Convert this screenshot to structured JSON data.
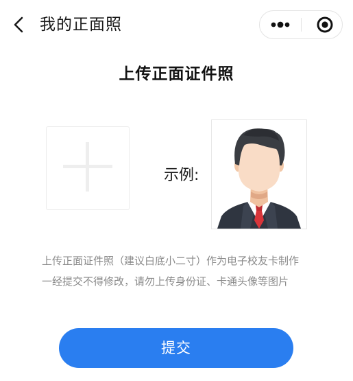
{
  "nav": {
    "title": "我的正面照",
    "back_icon": "chevron-left-icon",
    "more_icon": "more-dots-icon",
    "close_icon": "target-close-icon"
  },
  "main": {
    "heading": "上传正面证件照",
    "upload_icon": "plus-icon",
    "example_label": "示例:",
    "notice_lines": [
      "上传正面证件照（建议白底小二寸）作为电子校友卡制作",
      "一经提交不得修改，请勿上传身份证、卡通头像等图片"
    ]
  },
  "submit": {
    "label": "提交"
  },
  "colors": {
    "accent": "#2a7ef0",
    "notice_text": "#8a8a8a",
    "placeholder_plus": "#eeeeee"
  }
}
